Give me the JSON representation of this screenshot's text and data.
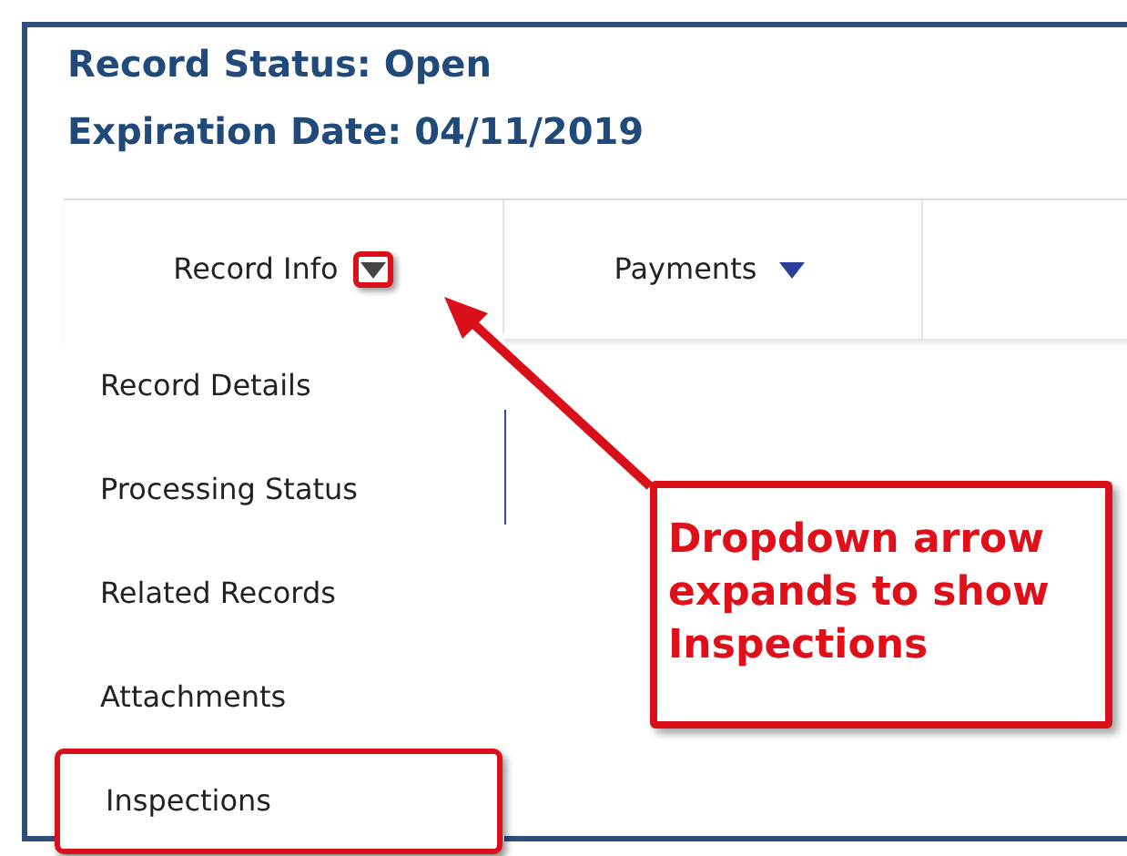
{
  "header": {
    "status": "Record Status: Open",
    "expiration": "Expiration Date: 04/11/2019"
  },
  "tabs": [
    {
      "label": "Record Info",
      "highlighted": true
    },
    {
      "label": "Payments",
      "highlighted": false
    }
  ],
  "menu": {
    "items": [
      {
        "label": "Record Details",
        "highlighted": false
      },
      {
        "label": "Processing Status",
        "highlighted": false
      },
      {
        "label": "Related Records",
        "highlighted": false
      },
      {
        "label": "Attachments",
        "highlighted": false
      },
      {
        "label": "Inspections",
        "highlighted": true
      }
    ]
  },
  "callout": {
    "text": "Dropdown arrow expands to show Inspections"
  }
}
